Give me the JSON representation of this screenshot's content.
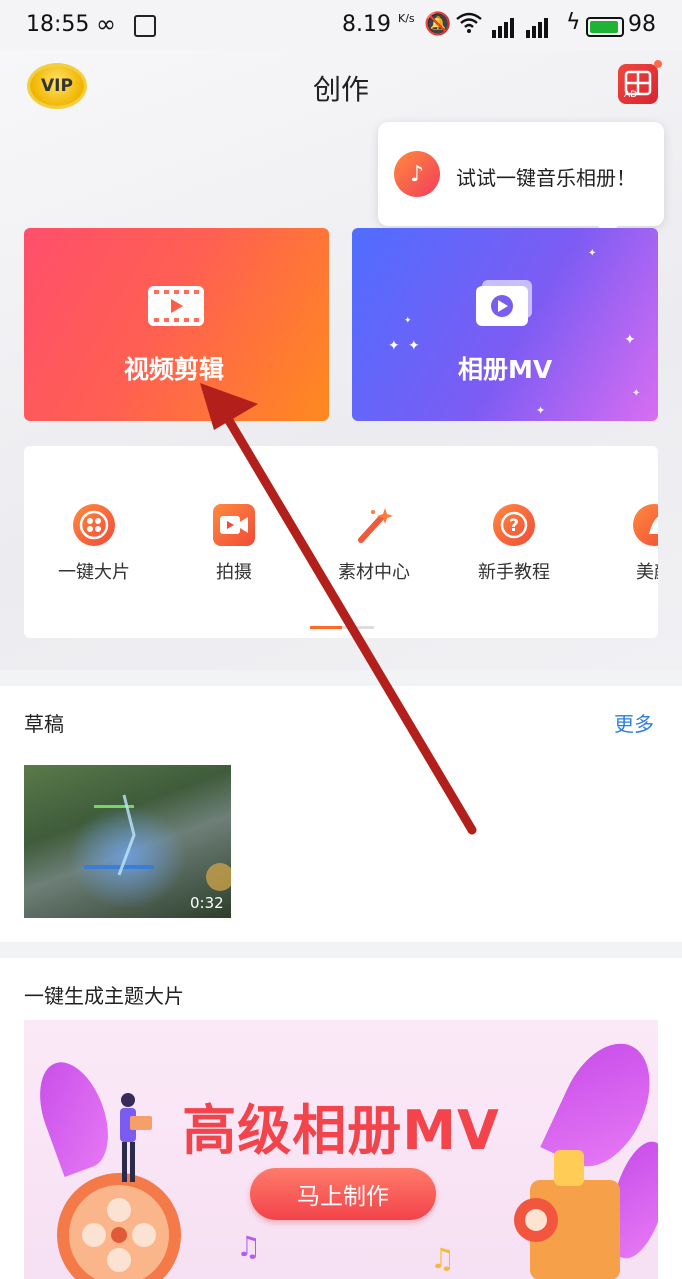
{
  "status_bar": {
    "time": "18:55",
    "infinity": "∞",
    "net_speed": "8.19",
    "net_unit": "K/s",
    "battery": "98"
  },
  "header": {
    "vip_label": "VIP",
    "title": "创作",
    "ad_label": "AD"
  },
  "tooltip": {
    "text": "试试一键音乐相册！"
  },
  "cards": {
    "video_edit": "视频剪辑",
    "album_mv": "相册MV"
  },
  "tools": [
    {
      "label": "一键大片",
      "icon": "film-reel-icon"
    },
    {
      "label": "拍摄",
      "icon": "camera-icon"
    },
    {
      "label": "素材中心",
      "icon": "magic-wand-icon"
    },
    {
      "label": "新手教程",
      "icon": "question-icon"
    },
    {
      "label": "美颜",
      "icon": "beauty-icon"
    }
  ],
  "drafts": {
    "title": "草稿",
    "more": "更多",
    "items": [
      {
        "duration": "0:32"
      }
    ]
  },
  "theme": {
    "title": "一键生成主题大片",
    "banner_title": "高级相册MV",
    "banner_button": "马上制作"
  },
  "colors": {
    "accent_orange": "#ff6a2a",
    "link_blue": "#2f7de1",
    "video_card_start": "#ff4f6c",
    "video_card_end": "#ff8a1f",
    "mv_card_start": "#4f6dff",
    "mv_card_end": "#d86ef2",
    "annotation_arrow": "#b3201c"
  }
}
